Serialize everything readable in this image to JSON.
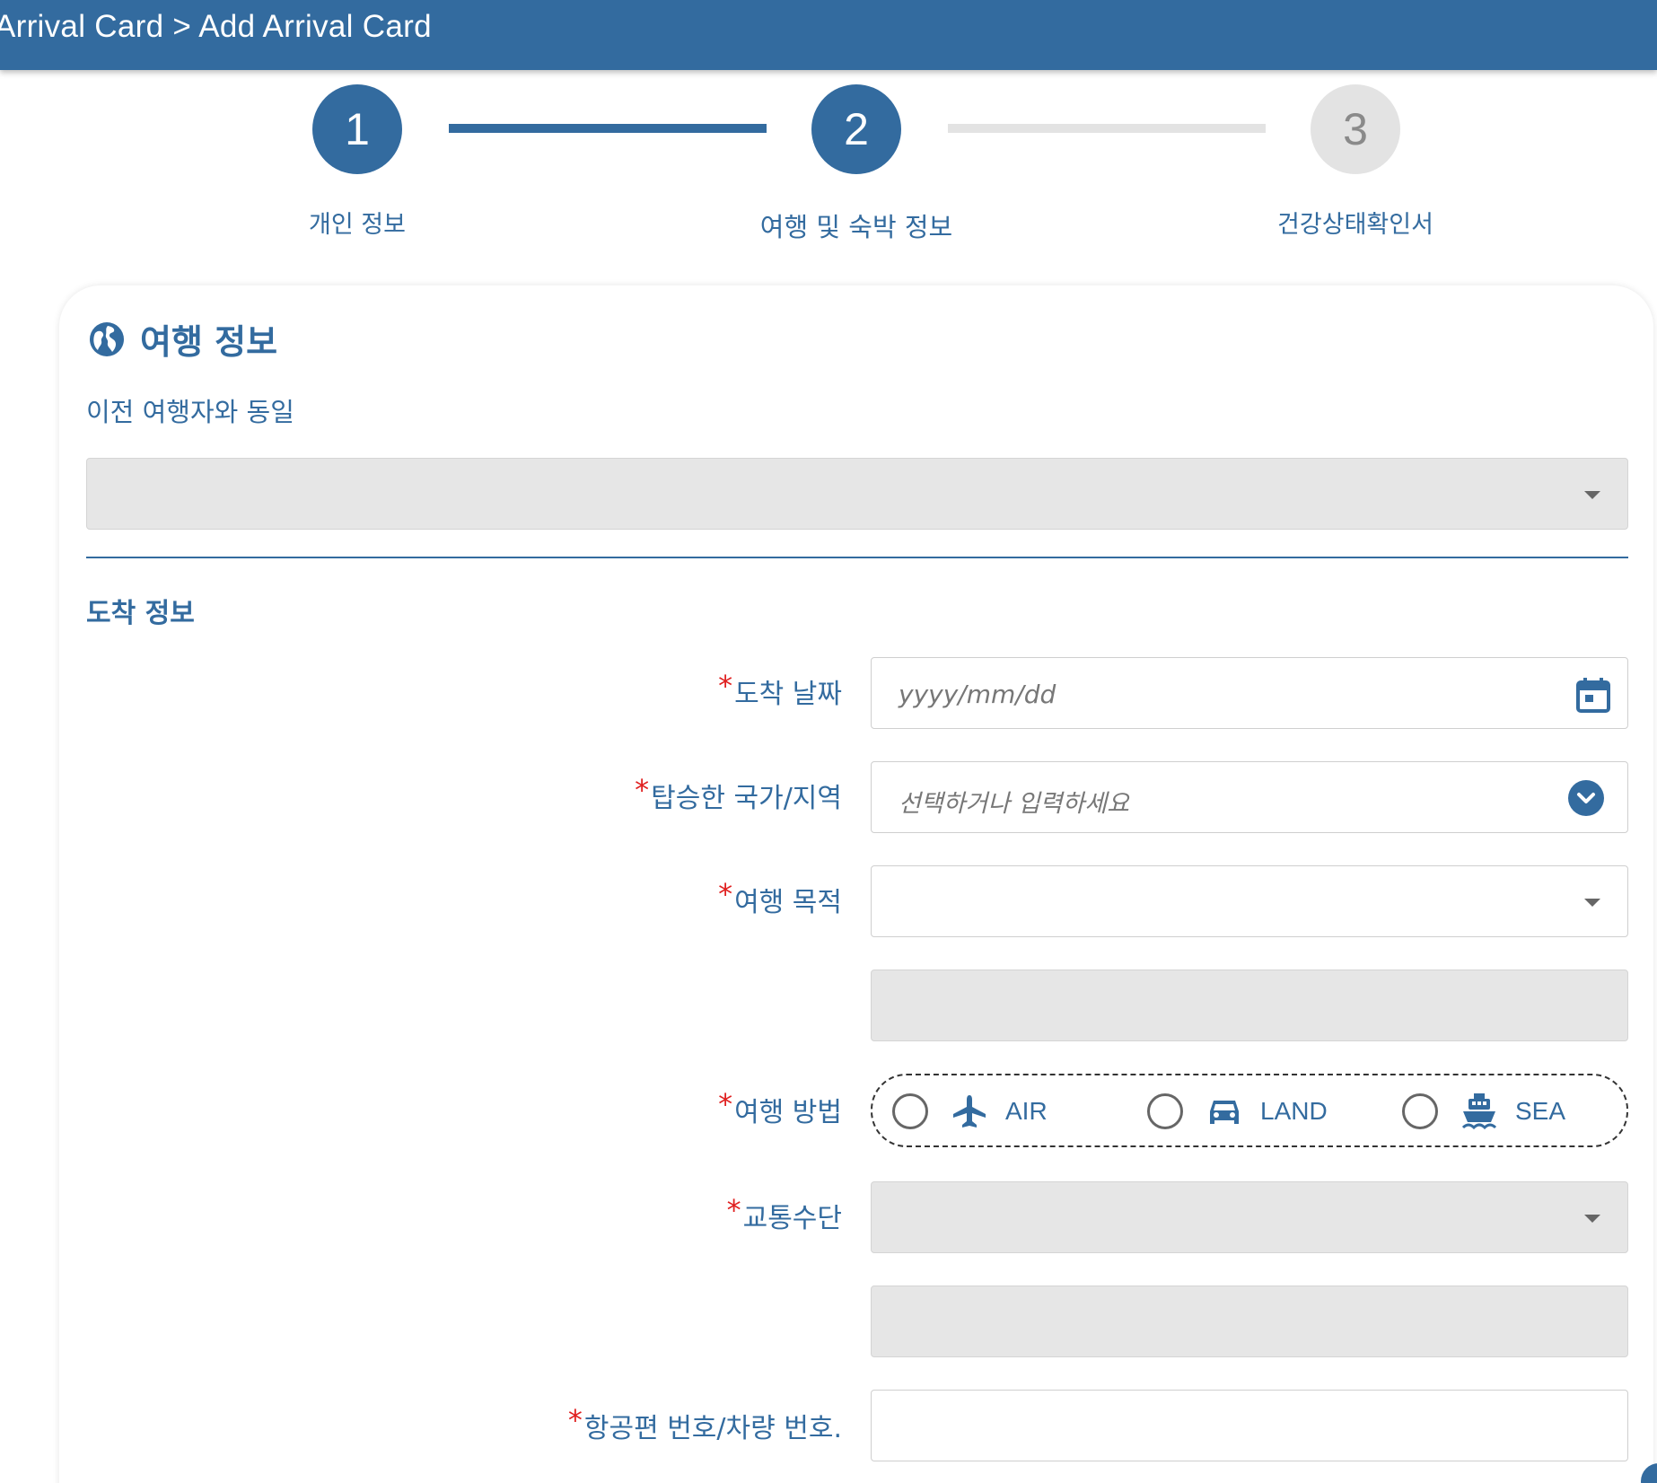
{
  "header": {
    "breadcrumb": "Arrival Card > Add Arrival Card"
  },
  "steps": [
    {
      "number": "1",
      "label": "개인 정보",
      "state": "completed"
    },
    {
      "number": "2",
      "label": "여행 및 숙박 정보",
      "state": "current"
    },
    {
      "number": "3",
      "label": "건강상태확인서",
      "state": "upcoming"
    }
  ],
  "travel_info": {
    "title": "여행 정보",
    "icon": "globe-icon",
    "same_as_previous_label": "이전 여행자와 동일"
  },
  "arrival_info": {
    "title": "도착 정보",
    "required_marker": "*",
    "arrival_date": {
      "label": "도착 날짜",
      "placeholder": "yyyy/mm/dd",
      "icon": "calendar-icon"
    },
    "boarding_country": {
      "label": "탑승한 국가/지역",
      "placeholder": "선택하거나 입력하세요",
      "icon": "chevron-down-circle-icon"
    },
    "travel_purpose": {
      "label": "여행 목적"
    },
    "travel_method": {
      "label": "여행 방법",
      "options": [
        {
          "label": "AIR",
          "icon": "airplane-icon"
        },
        {
          "label": "LAND",
          "icon": "car-icon"
        },
        {
          "label": "SEA",
          "icon": "ship-icon"
        }
      ]
    },
    "transport": {
      "label": "교통수단"
    },
    "flight_vehicle_number": {
      "label": "항공편 번호/차량 번호."
    }
  },
  "colors": {
    "primary": "#336b9f",
    "required": "#e02020",
    "disabled": "#e6e6e6",
    "inactive_step": "#e3e3e3"
  }
}
